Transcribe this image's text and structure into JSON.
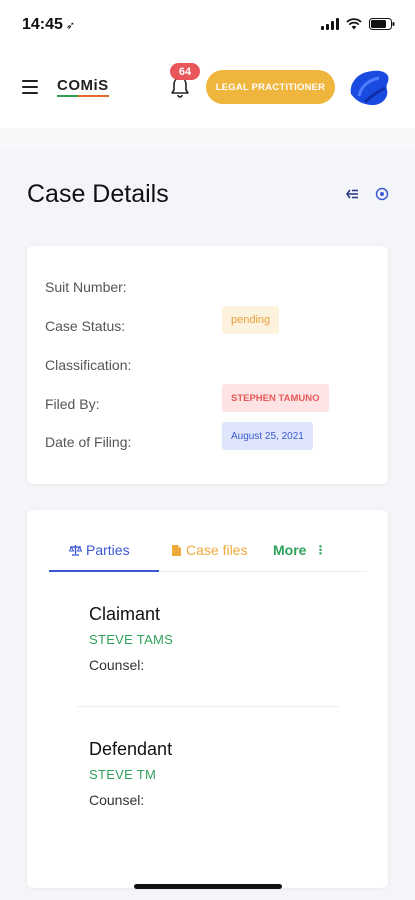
{
  "status": {
    "time": "14:45"
  },
  "header": {
    "logo": "COMiS",
    "notification_count": "64",
    "role": "LEGAL PRACTITIONER"
  },
  "page": {
    "title": "Case Details"
  },
  "details": {
    "suit_number_label": "Suit Number:",
    "case_status_label": "Case Status:",
    "case_status_value": "pending",
    "classification_label": "Classification:",
    "filed_by_label": "Filed By:",
    "filed_by_value": "STEPHEN TAMUNO",
    "date_label": "Date of Filing:",
    "date_value": "August 25, 2021"
  },
  "tabs": {
    "parties": "Parties",
    "case_files": "Case files",
    "more": "More"
  },
  "parties": [
    {
      "role": "Claimant",
      "name": "STEVE TAMS",
      "counsel_label": "Counsel:"
    },
    {
      "role": "Defendant",
      "name": "STEVE TM",
      "counsel_label": "Counsel:"
    }
  ],
  "colors": {
    "accent_blue": "#3b58d4",
    "accent_green": "#2fa25a",
    "accent_orange": "#f0b53c",
    "badge_red": "#e9565a"
  },
  "icons": {
    "navigation": "arrow-icon",
    "menu": "hamburger-icon",
    "notifications": "bell-icon",
    "back": "collapse-left-icon",
    "settings": "target-icon",
    "parties_tab": "scales-icon",
    "files_tab": "file-icon",
    "more_tab": "kebab-icon"
  }
}
